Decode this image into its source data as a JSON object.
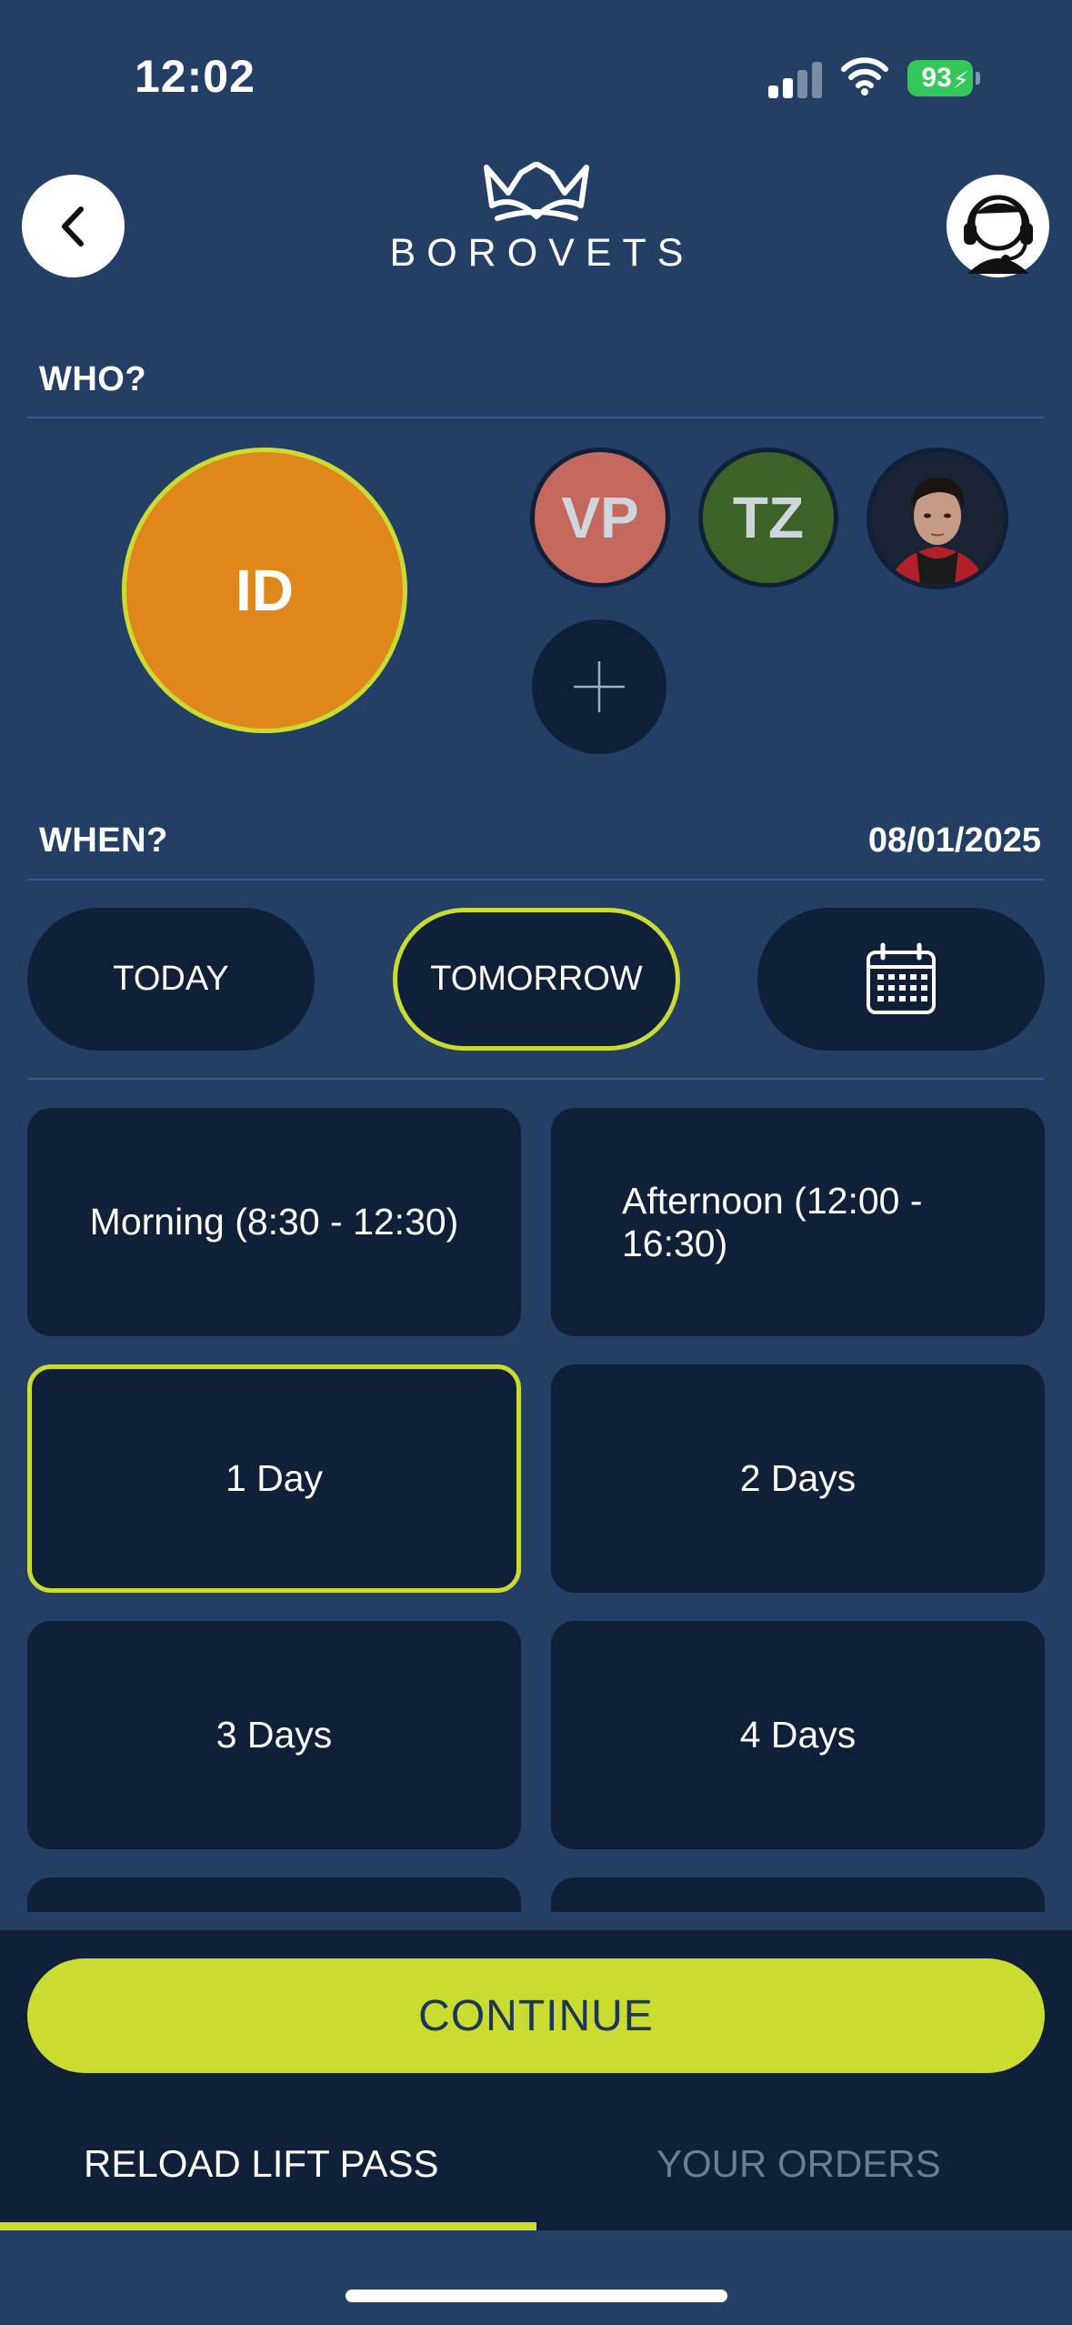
{
  "status_bar": {
    "time": "12:02",
    "battery": "93"
  },
  "header": {
    "logo_text": "BOROVETS"
  },
  "who": {
    "label": "WHO?",
    "selected_member": {
      "initials": "ID",
      "color": "#e0871b"
    },
    "members": [
      {
        "initials": "VP",
        "color": "#c4685e"
      },
      {
        "initials": "TZ",
        "color": "#3c6228"
      }
    ]
  },
  "when": {
    "label": "WHEN?",
    "date": "08/01/2025",
    "quick_dates": [
      {
        "label": "TODAY",
        "selected": false
      },
      {
        "label": "TOMORROW",
        "selected": true
      }
    ]
  },
  "options": [
    {
      "label": "Morning (8:30 - 12:30)",
      "selected": false
    },
    {
      "label": "Afternoon (12:00 - 16:30)",
      "selected": false
    },
    {
      "label": "1 Day",
      "selected": true
    },
    {
      "label": "2 Days",
      "selected": false
    },
    {
      "label": "3 Days",
      "selected": false
    },
    {
      "label": "4 Days",
      "selected": false
    }
  ],
  "continue_label": "CONTINUE",
  "tabs": [
    {
      "label": "RELOAD LIFT PASS",
      "active": true
    },
    {
      "label": "YOUR ORDERS",
      "active": false
    }
  ],
  "colors": {
    "background": "#233f66",
    "panel": "#0f2038",
    "accent": "#c9dc2f"
  }
}
